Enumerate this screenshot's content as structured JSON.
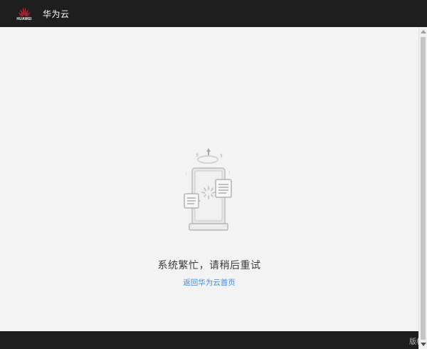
{
  "header": {
    "logo_text": "HUAWEI",
    "brand_name": "华为云"
  },
  "error": {
    "message": "系统繁忙，请稍后重试",
    "home_link": "返回华为云首页"
  },
  "footer": {
    "text": "版权"
  },
  "colors": {
    "header_bg": "#1e1e1e",
    "page_bg": "#f3f3f3",
    "link": "#3c8be8",
    "logo_red": "#e6262c"
  },
  "icons": {
    "logo": "huawei-flower-logo",
    "illustration": "system-busy-illustration"
  }
}
